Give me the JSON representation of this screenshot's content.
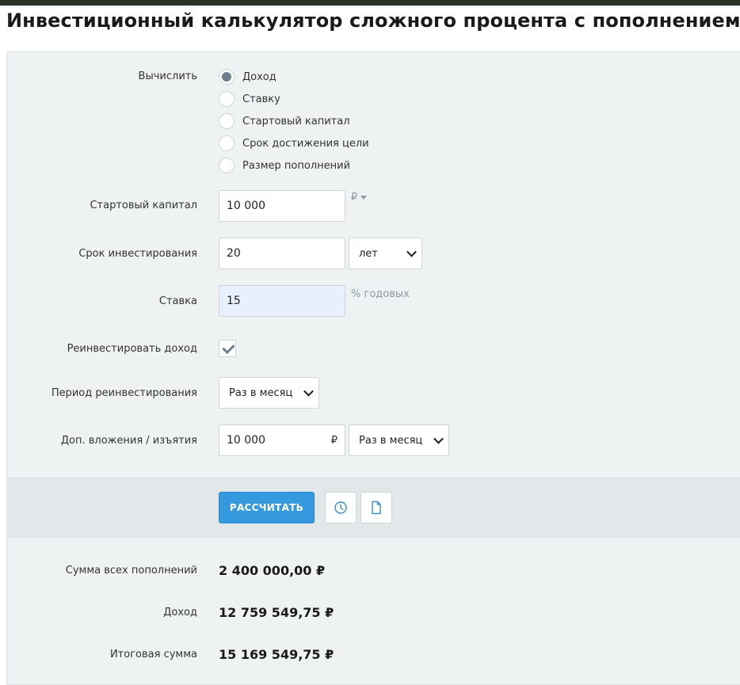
{
  "page": {
    "title": "Инвестиционный калькулятор сложного процента с пополнением"
  },
  "form": {
    "compute": {
      "label": "Вычислить",
      "options": [
        "Доход",
        "Ставку",
        "Стартовый капитал",
        "Срок достижения цели",
        "Размер пополнений"
      ],
      "selected": "Доход"
    },
    "start_capital": {
      "label": "Стартовый капитал",
      "value": "10 000",
      "currency": "₽"
    },
    "term": {
      "label": "Срок инвестирования",
      "value": "20",
      "unit_selected": "лет"
    },
    "rate": {
      "label": "Ставка",
      "value": "15",
      "unit": "% годовых"
    },
    "reinvest": {
      "label": "Реинвестировать доход",
      "checked": true
    },
    "reinvest_period": {
      "label": "Период реинвестирования",
      "selected": "Раз в месяц"
    },
    "contributions": {
      "label": "Доп. вложения / изъятия",
      "value": "10 000",
      "currency": "₽",
      "period_selected": "Раз в месяц"
    }
  },
  "actions": {
    "calculate_label": "РАССЧИТАТЬ",
    "history_icon": "clock-icon",
    "document_icon": "document-icon"
  },
  "results": [
    {
      "label": "Сумма всех пополнений",
      "value": "2 400 000,00 ₽"
    },
    {
      "label": "Доход",
      "value": "12 759 549,75 ₽"
    },
    {
      "label": "Итоговая сумма",
      "value": "15 169 549,75 ₽"
    }
  ],
  "colors": {
    "top_bar": "#2b3227",
    "panel_bg": "#eef2f2",
    "actions_bg": "#e2e8ea",
    "primary_button": "#3499dd",
    "radio_checked": "#6c7f8c",
    "rate_input_bg": "#e8f0fe"
  }
}
